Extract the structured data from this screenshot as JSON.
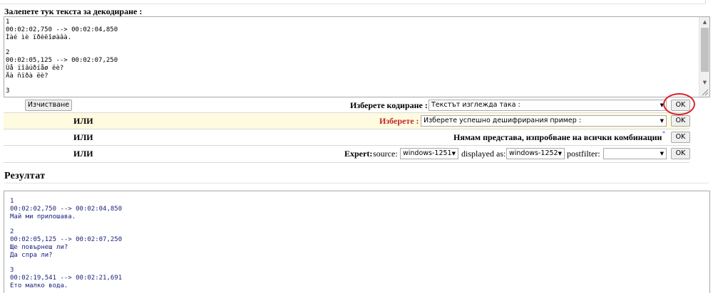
{
  "paste_label": "Залепете тук текста за декодиране :",
  "input_text": "1\n00:02:02,750 --> 00:02:04,850\nÌàé ìè ïðèëîøàâà.\n\n2\n00:02:05,125 --> 00:02:07,250\nÙå ïîâúðíåø ëè?\nÄà ñïðà ëè?\n\n3",
  "clear_button": "Изчистване",
  "choose_encoding_label": "Изберете кодиране :",
  "encoding_select_value": "Текстът изглежда така :",
  "ok_label": "OK",
  "or_label": "ИЛИ",
  "choose_example_label": "Изберете :",
  "example_select_value": "Изберете успешно дешифрирания пример :",
  "try_all_label": "Нямам представа, изпробване на всички комбинации",
  "help_mark": "*",
  "expert_label": "Expert:",
  "source_label": "source:",
  "source_value": "windows-1251",
  "displayed_as_label": "displayed as:",
  "displayed_as_value": "windows-1252",
  "postfilter_label": "postfilter:",
  "postfilter_value": "",
  "result_title": "Резултат",
  "output_text": "1\n00:02:02,750 --> 00:02:04,850\nМай ми прилошава.\n\n2\n00:02:05,125 --> 00:02:07,250\nЩе повърнеш ли?\nДа спра ли?\n\n3\n00:02:19,541 --> 00:02:21,691\nЕто малко вода.",
  "colors": {
    "highlight_row": "#fffbe0",
    "red_label": "#c0282d",
    "annotation_circle": "#d9232d",
    "output_text": "#1a237e"
  },
  "icons": {
    "select_arrow": "▼",
    "scroll_up": "▲",
    "scroll_down": "▼"
  }
}
